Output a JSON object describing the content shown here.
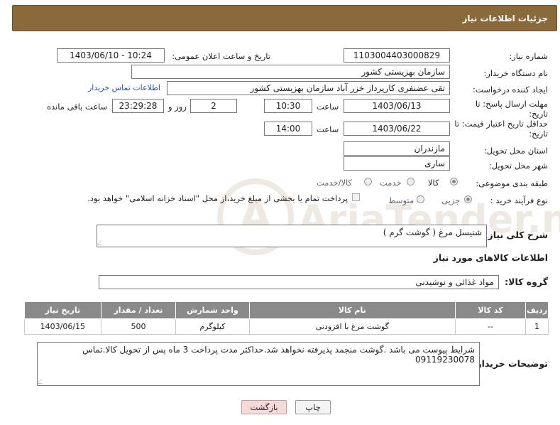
{
  "header": {
    "title": "جزئیات اطلاعات نیاز"
  },
  "fields": {
    "need_number_label": "شماره نیاز:",
    "need_number": "1103004403000829",
    "announce_label": "تاریخ و ساعت اعلان عمومی:",
    "announce_value": "1403/06/10 - 10:24",
    "buyer_org_label": "نام دستگاه خریدار:",
    "buyer_org": "سازمان بهزیستی کشور",
    "requester_label": "ایجاد کننده درخواست:",
    "requester": "تقی عضنفری کارپرداز خزر آباد سازمان بهزیستی کشور",
    "contact_link": "اطلاعات تماس خریدار",
    "deadline_label": "مهلت ارسال پاسخ: تا تاریخ:",
    "deadline_date": "1403/06/13",
    "time_label": "ساعت",
    "deadline_time": "10:30",
    "days_value": "2",
    "days_label": "روز و",
    "remaining_time": "23:29:28",
    "remaining_label": "ساعت باقی مانده",
    "price_validity_label": "حداقل تاریخ اعتبار قیمت: تا تاریخ:",
    "price_validity_date": "1403/06/22",
    "price_validity_time": "14:00",
    "province_label": "استان محل تحویل:",
    "province": "مازندران",
    "city_label": "شهر محل تحویل:",
    "city": "ساری",
    "category_label": "طبقه بندی موضوعی:",
    "category_options": [
      "کالا",
      "خدمت",
      "کالا/خدمت"
    ],
    "process_label": "نوع فرآیند خرید :",
    "process_options": [
      "جزیی",
      "متوسط"
    ],
    "payment_note": "پرداخت تمام یا بخشی از مبلغ خرید،از محل \"اسناد خزانه اسلامی\" خواهد بود."
  },
  "summary": {
    "label": "شرح کلی نیاز:",
    "value": "شنیسل مرغ ( گوشت گرم )"
  },
  "goods_section_title": "اطلاعات کالاهای مورد نیاز",
  "goods_group": {
    "label": "گروه کالا:",
    "value": "مواد غذائی و نوشیدنی"
  },
  "table": {
    "headers": [
      "ردیف",
      "کد کالا",
      "نام کالا",
      "واحد شمارش",
      "تعداد / مقدار",
      "تاریخ نیاز"
    ],
    "rows": [
      [
        "1",
        "--",
        "گوشت مرغ با افزودنی",
        "کیلوگرم",
        "500",
        "1403/06/15"
      ]
    ]
  },
  "buyer_notes": {
    "label": "توضیحات خریدار:",
    "value": "شرایط پیوست می باشد .گوشت منجمد پذیرفته نخواهد شد.حداکثر مدت پرداخت 3 ماه پس از تحویل کالا.تماس 09119230078"
  },
  "buttons": {
    "print": "چاپ",
    "back": "بازگشت"
  },
  "watermark_text": "AriaTender.neT",
  "colors": {
    "header": "#8a6a3b",
    "table_header": "#8a8a8a",
    "back_button": "#f6d9d9",
    "print_button": "#f4f4f4",
    "link": "#2a4fb5"
  }
}
